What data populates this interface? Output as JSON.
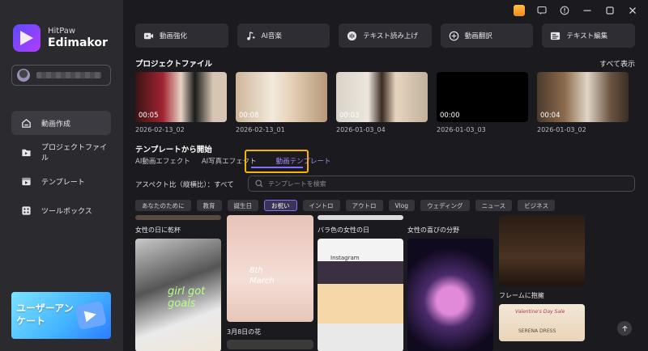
{
  "app": {
    "brand_small": "HitPaw",
    "brand_big": "Edimakor"
  },
  "sidebar": {
    "items": [
      {
        "label": "動画作成",
        "icon": "home-icon",
        "active": true
      },
      {
        "label": "プロジェクトファイル",
        "icon": "folder-icon",
        "active": false
      },
      {
        "label": "テンプレート",
        "icon": "template-icon",
        "active": false
      },
      {
        "label": "ツールボックス",
        "icon": "toolbox-icon",
        "active": false
      }
    ],
    "survey_label": "ユーザーアンケート"
  },
  "tools": [
    {
      "label": "動画強化",
      "icon": "video-enhance-icon"
    },
    {
      "label": "AI音楽",
      "icon": "music-icon"
    },
    {
      "label": "テキスト読み上げ",
      "icon": "tts-icon"
    },
    {
      "label": "動画翻訳",
      "icon": "translate-icon"
    },
    {
      "label": "テキスト編集",
      "icon": "text-edit-icon"
    }
  ],
  "projects": {
    "title": "プロジェクトファイル",
    "see_all": "すべて表示",
    "items": [
      {
        "duration": "00:05",
        "date": "2026-02-13_02"
      },
      {
        "duration": "00:08",
        "date": "2026-02-13_01"
      },
      {
        "duration": "00:03",
        "date": "2026-01-03_04"
      },
      {
        "duration": "00:00",
        "date": "2026-01-03_03"
      },
      {
        "duration": "00:04",
        "date": "2026-01-03_02"
      }
    ]
  },
  "templates": {
    "title": "テンプレートから開始",
    "tabs": [
      "AI動画エフェクト",
      "AI写真エフェクト",
      "動画テンプレート"
    ],
    "aspect_label": "アスペクト比（縦横比）：すべて",
    "search_placeholder": "テンプレートを検索",
    "chips": [
      "あなたのために",
      "教育",
      "誕生日",
      "お祝い",
      "イントロ",
      "アウトロ",
      "Vlog",
      "ウェディング",
      "ニュース",
      "ビジネス"
    ],
    "cards": {
      "c1": "女性の日に乾杯",
      "c2": "3月8日の花",
      "c3": "バラ色の女性の日",
      "c4": "女性の喜びの分野",
      "c5": "フレームに抱擁"
    },
    "card_texts": {
      "girl": "girl got goals",
      "march": "8th March",
      "insta": "Instagram",
      "valentine": "Valentine's Day Sale",
      "serena": "SERENA DRESS"
    }
  },
  "colors": {
    "accent": "#8a6bff",
    "highlight": "#f4b400"
  }
}
